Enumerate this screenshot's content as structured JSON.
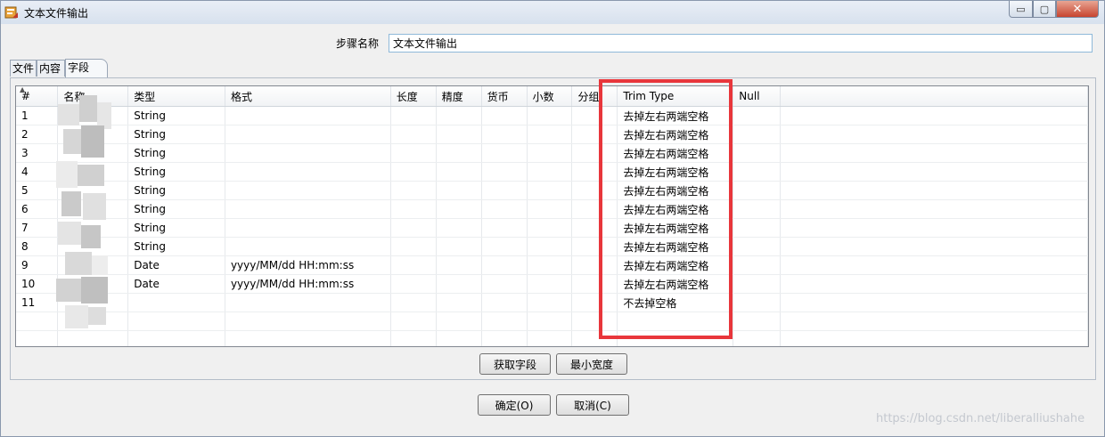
{
  "window": {
    "title": "文本文件输出",
    "controls": {
      "minimize": "▭",
      "maximize": "▢",
      "close": "✕"
    }
  },
  "step": {
    "label": "步骤名称",
    "value": "文本文件输出"
  },
  "tabs": [
    {
      "label": "文件"
    },
    {
      "label": "内容"
    },
    {
      "label": "字段"
    }
  ],
  "table": {
    "columns": [
      "#",
      "名称",
      "类型",
      "格式",
      "长度",
      "精度",
      "货币",
      "小数",
      "分组",
      "Trim Type",
      "Null"
    ],
    "rows": [
      {
        "num": "1",
        "type": "String",
        "format": "",
        "trim": "去掉左右两端空格"
      },
      {
        "num": "2",
        "type": "String",
        "format": "",
        "trim": "去掉左右两端空格"
      },
      {
        "num": "3",
        "type": "String",
        "format": "",
        "trim": "去掉左右两端空格"
      },
      {
        "num": "4",
        "type": "String",
        "format": "",
        "trim": "去掉左右两端空格"
      },
      {
        "num": "5",
        "type": "String",
        "format": "",
        "trim": "去掉左右两端空格"
      },
      {
        "num": "6",
        "type": "String",
        "format": "",
        "trim": "去掉左右两端空格"
      },
      {
        "num": "7",
        "type": "String",
        "format": "",
        "trim": "去掉左右两端空格"
      },
      {
        "num": "8",
        "type": "String",
        "format": "",
        "trim": "去掉左右两端空格"
      },
      {
        "num": "9",
        "type": "Date",
        "format": "yyyy/MM/dd HH:mm:ss",
        "trim": "去掉左右两端空格"
      },
      {
        "num": "10",
        "type": "Date",
        "format": "yyyy/MM/dd HH:mm:ss",
        "trim": "去掉左右两端空格"
      },
      {
        "num": "11",
        "type": "",
        "format": "",
        "trim": "不去掉空格"
      }
    ]
  },
  "buttons": {
    "get_fields": "获取字段",
    "min_width": "最小宽度",
    "ok": "确定(O)",
    "cancel": "取消(C)"
  },
  "watermark": "https://blog.csdn.net/liberalliushahe",
  "colors": {
    "highlight": "#e8363b",
    "input_border": "#8fb9d9"
  }
}
